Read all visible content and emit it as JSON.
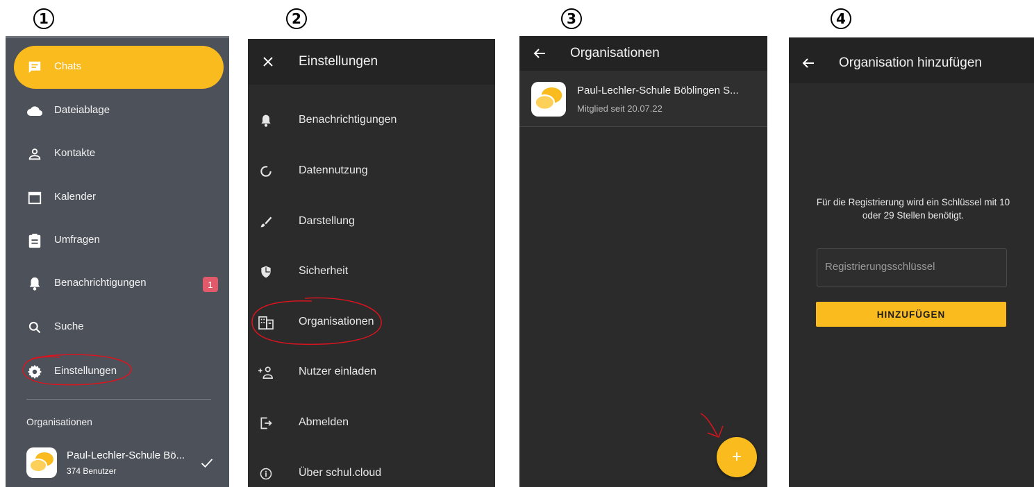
{
  "steps": [
    "1",
    "2",
    "3",
    "4"
  ],
  "colors": {
    "accent": "#f9bb1d",
    "badge": "#e05a6b",
    "annotation": "#d9141e"
  },
  "panel1": {
    "items": [
      {
        "label": "Chats",
        "icon": "chat-icon",
        "active": true
      },
      {
        "label": "Dateiablage",
        "icon": "cloud-icon"
      },
      {
        "label": "Kontakte",
        "icon": "person-icon"
      },
      {
        "label": "Kalender",
        "icon": "calendar-icon"
      },
      {
        "label": "Umfragen",
        "icon": "clipboard-icon"
      },
      {
        "label": "Benachrichtigungen",
        "icon": "bell-icon",
        "badge": "1"
      },
      {
        "label": "Suche",
        "icon": "search-icon"
      },
      {
        "label": "Einstellungen",
        "icon": "gear-icon"
      }
    ],
    "section_title": "Organisationen",
    "org": {
      "name": "Paul-Lechler-Schule Bö...",
      "members": "374 Benutzer"
    }
  },
  "panel2": {
    "title": "Einstellungen",
    "items": [
      {
        "label": "Benachrichtigungen",
        "icon": "bell-icon"
      },
      {
        "label": "Datennutzung",
        "icon": "data-usage-icon"
      },
      {
        "label": "Darstellung",
        "icon": "brush-icon"
      },
      {
        "label": "Sicherheit",
        "icon": "shield-icon"
      },
      {
        "label": "Organisationen",
        "icon": "building-icon"
      },
      {
        "label": "Nutzer einladen",
        "icon": "add-person-icon"
      },
      {
        "label": "Abmelden",
        "icon": "logout-icon"
      },
      {
        "label": "Über schul.cloud",
        "icon": "info-icon"
      }
    ]
  },
  "panel3": {
    "title": "Organisationen",
    "org": {
      "name": "Paul-Lechler-Schule Böblingen S...",
      "since": "Mitglied seit 20.07.22"
    },
    "fab": "+"
  },
  "panel4": {
    "title": "Organisation hinzufügen",
    "info": "Für die Registrierung wird ein Schlüssel mit 10 oder 29 Stellen benötigt.",
    "input_placeholder": "Registrierungsschlüssel",
    "button": "HINZUFÜGEN"
  }
}
